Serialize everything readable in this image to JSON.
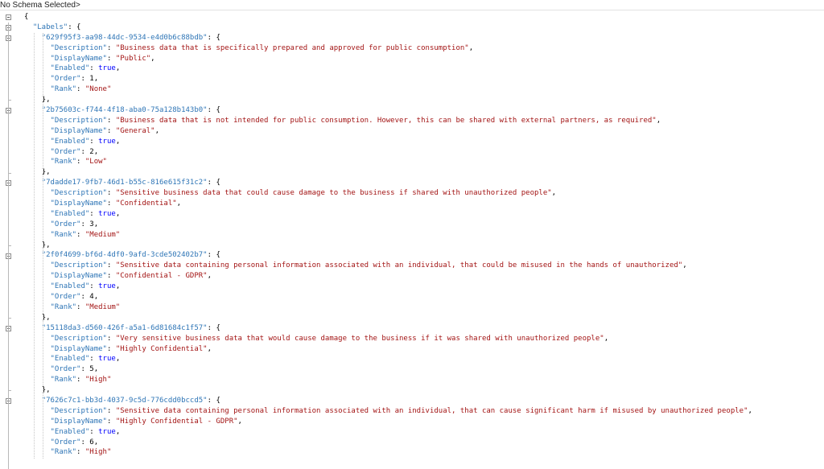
{
  "schema_bar": {
    "text": "No Schema Selected>"
  },
  "icons": {
    "fold": "collapse-minus-icon"
  },
  "colors": {
    "key": "#2e75b6",
    "string": "#a31515",
    "boolean": "#0000ff",
    "punct": "#000000"
  },
  "lines": [
    "{",
    "  \"Labels\": {",
    "    \"629f95f3-aa98-44dc-9534-e4d0b6c88bdb\": {",
    "      \"Description\": \"Business data that is specifically prepared and approved for public consumption\",",
    "      \"DisplayName\": \"Public\",",
    "      \"Enabled\": true,",
    "      \"Order\": 1,",
    "      \"Rank\": \"None\"",
    "    },",
    "    \"2b75603c-f744-4f18-aba0-75a128b143b0\": {",
    "      \"Description\": \"Business data that is not intended for public consumption. However, this can be shared with external partners, as required\",",
    "      \"DisplayName\": \"General\",",
    "      \"Enabled\": true,",
    "      \"Order\": 2,",
    "      \"Rank\": \"Low\"",
    "    },",
    "    \"7dadde17-9fb7-46d1-b55c-816e615f31c2\": {",
    "      \"Description\": \"Sensitive business data that could cause damage to the business if shared with unauthorized people\",",
    "      \"DisplayName\": \"Confidential\",",
    "      \"Enabled\": true,",
    "      \"Order\": 3,",
    "      \"Rank\": \"Medium\"",
    "    },",
    "    \"2f0f4699-bf6d-4df0-9afd-3cde502402b7\": {",
    "      \"Description\": \"Sensitive data containing personal information associated with an individual, that could be misused in the hands of unauthorized\",",
    "      \"DisplayName\": \"Confidential - GDPR\",",
    "      \"Enabled\": true,",
    "      \"Order\": 4,",
    "      \"Rank\": \"Medium\"",
    "    },",
    "    \"15118da3-d560-426f-a5a1-6d81684c1f57\": {",
    "      \"Description\": \"Very sensitive business data that would cause damage to the business if it was shared with unauthorized people\",",
    "      \"DisplayName\": \"Highly Confidential\",",
    "      \"Enabled\": true,",
    "      \"Order\": 5,",
    "      \"Rank\": \"High\"",
    "    },",
    "    \"7626c7c1-bb3d-4037-9c5d-776cdd0bccd5\": {",
    "      \"Description\": \"Sensitive data containing personal information associated with an individual, that can cause significant harm if misused by unauthorized people\",",
    "      \"DisplayName\": \"Highly Confidential - GDPR\",",
    "      \"Enabled\": true,",
    "      \"Order\": 6,",
    "      \"Rank\": \"High\""
  ]
}
